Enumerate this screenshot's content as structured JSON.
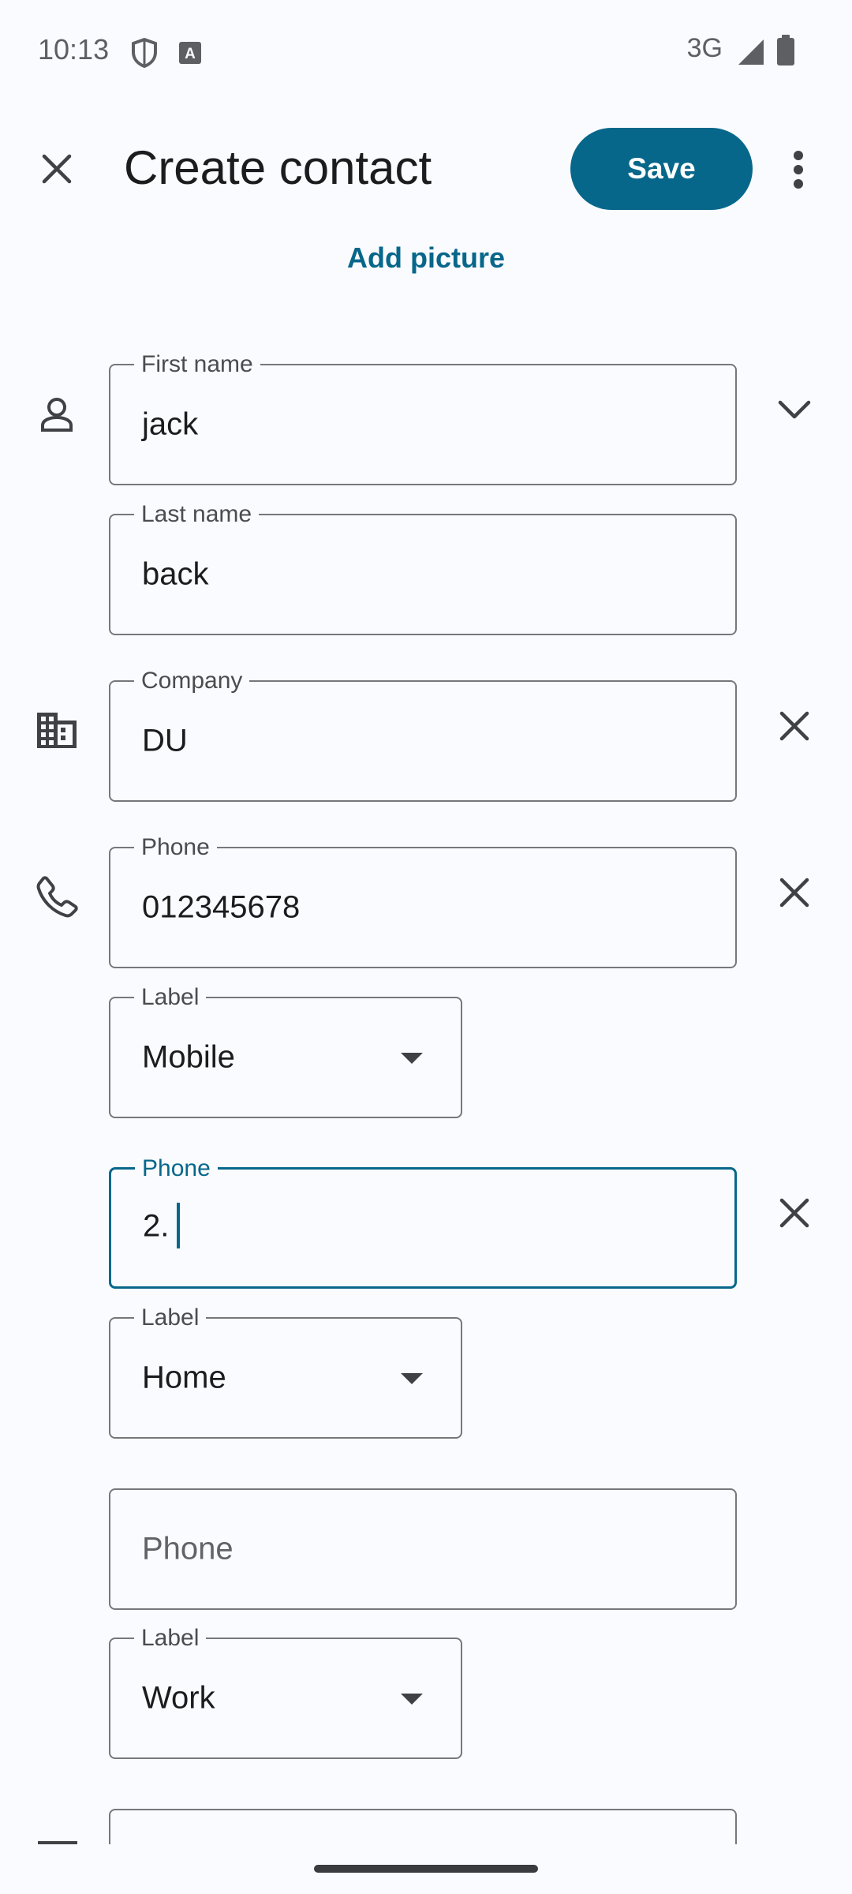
{
  "status_bar": {
    "time": "10:13",
    "network": "3G",
    "icons": [
      "shield-icon",
      "keyboard-a-icon",
      "signal-icon",
      "battery-icon"
    ]
  },
  "app_bar": {
    "title": "Create contact",
    "save_label": "Save",
    "close_icon": "close-icon",
    "more_icon": "more-vert-icon"
  },
  "add_picture_label": "Add picture",
  "name": {
    "first_label": "First name",
    "first_value": "jack",
    "last_label": "Last name",
    "last_value": "back"
  },
  "company": {
    "label": "Company",
    "value": "DU"
  },
  "phones": [
    {
      "label": "Phone",
      "value": "012345678",
      "type_label": "Label",
      "type_value": "Mobile"
    },
    {
      "label": "Phone",
      "value": "2.",
      "type_label": "Label",
      "type_value": "Home"
    },
    {
      "placeholder": "Phone",
      "type_label": "Label",
      "type_value": "Work"
    }
  ],
  "colors": {
    "accent": "#07678b",
    "background": "#fafbfe",
    "outline": "#75777b"
  }
}
